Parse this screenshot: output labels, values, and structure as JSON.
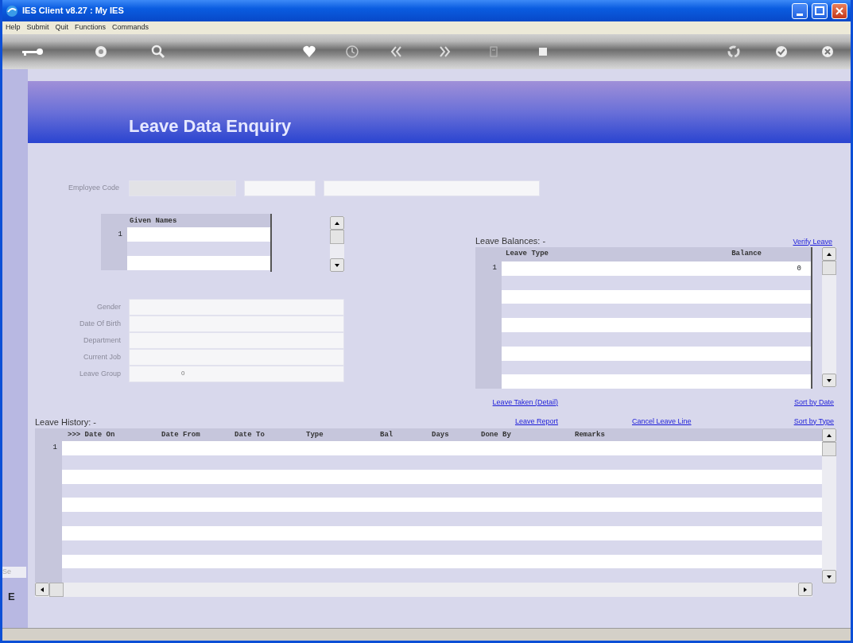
{
  "window": {
    "title": "IES Client v8.27 : My IES"
  },
  "menu": [
    "Help",
    "Submit",
    "Quit",
    "Functions",
    "Commands"
  ],
  "banner": {
    "title": "Leave Data Enquiry"
  },
  "employee_code": {
    "label": "Employee Code"
  },
  "given_names": {
    "column": "Given Names",
    "rows": [
      {
        "number": "1"
      }
    ]
  },
  "details": [
    {
      "label": "Gender"
    },
    {
      "label": "Date Of Birth"
    },
    {
      "label": "Department"
    },
    {
      "label": "Current Job"
    },
    {
      "label": "Leave Group",
      "value": "0"
    }
  ],
  "leave_balances": {
    "title": "Leave Balances: -",
    "link": "Verify Leave",
    "columns": [
      "Leave Type",
      "Balance"
    ],
    "rows": [
      {
        "number": "1",
        "balance": "0"
      }
    ]
  },
  "links": {
    "leave_taken": "Leave Taken (Detail)",
    "sort_by_date": "Sort by Date",
    "leave_report": "Leave Report",
    "cancel_leave_line": "Cancel Leave Line",
    "sort_by_type": "Sort by Type"
  },
  "leave_history": {
    "title": "Leave History: -",
    "columns": [
      ">>> Date On",
      "Date From",
      "Date To",
      "Type",
      "Bal",
      "Days",
      "Done By",
      "Remarks"
    ],
    "rows": [
      {
        "number": "1"
      }
    ]
  },
  "side_strip": {
    "texts": [
      "Se",
      "E"
    ]
  }
}
